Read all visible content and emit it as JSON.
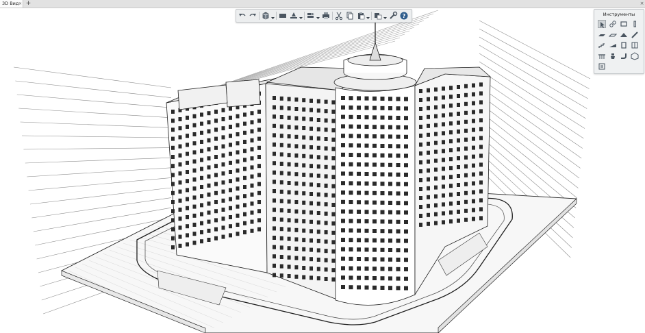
{
  "tabs": {
    "active_label": "3D Вид",
    "close_glyph": "×",
    "add_glyph": "+",
    "window_close_glyph": "×"
  },
  "toolbar": {
    "buttons": [
      {
        "icon": "undo-icon"
      },
      {
        "icon": "redo-icon"
      },
      {
        "icon": "view-cube-icon",
        "dropdown": true
      },
      {
        "icon": "section-box-icon"
      },
      {
        "icon": "level-plane-icon",
        "dropdown": true
      },
      {
        "icon": "layers-icon",
        "dropdown": true
      },
      {
        "icon": "print-icon"
      },
      {
        "icon": "cut-icon"
      },
      {
        "icon": "copy-icon"
      },
      {
        "icon": "paste-icon",
        "dropdown": true
      },
      {
        "icon": "display-settings-icon",
        "dropdown": true
      },
      {
        "icon": "wrench-icon"
      },
      {
        "icon": "help-icon"
      }
    ]
  },
  "tools_panel": {
    "title": "Инструменты",
    "items": [
      "select-cursor-icon",
      "link-tool-icon",
      "wall-tool-icon",
      "column-tool-icon",
      "slab-tool-icon",
      "floor-tool-icon",
      "roof-tool-icon",
      "beam-tool-icon",
      "stair-tool-icon",
      "ramp-tool-icon",
      "door-tool-icon",
      "window-tool-icon",
      "railing-tool-icon",
      "plumbing-tool-icon",
      "pipe-tool-icon",
      "object-tool-icon",
      "annotation-tool-icon"
    ]
  },
  "viewport": {
    "content": "3d-building-model",
    "level_lines": 19
  },
  "colors": {
    "tab_bar": "#e2e2e2",
    "toolbar_bg": "#eceeef",
    "icon_color": "#4a5560",
    "help_icon": "#2e5d8c",
    "model_lines": "#1c1c1c",
    "background": "#ffffff"
  }
}
